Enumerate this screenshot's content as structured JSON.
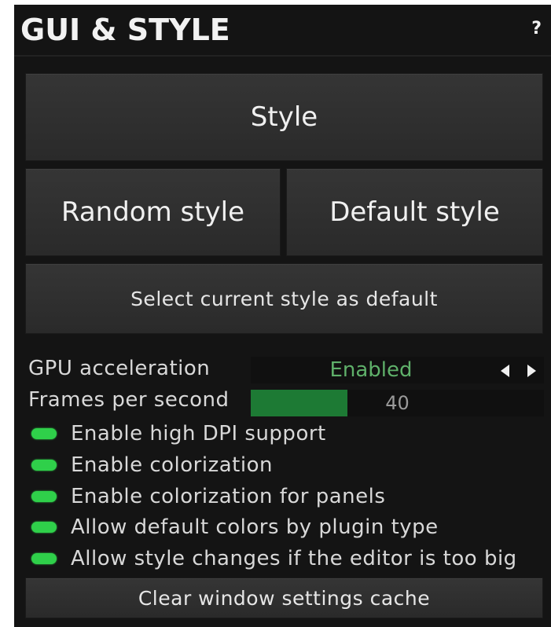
{
  "header": {
    "title": "GUI & STYLE",
    "help_label": "?"
  },
  "buttons": {
    "style": "Style",
    "random_style": "Random style",
    "default_style": "Default style",
    "select_default": "Select current style as default",
    "clear_cache": "Clear window settings cache"
  },
  "gpu": {
    "label": "GPU acceleration",
    "value": "Enabled",
    "value_color": "#5fb06a"
  },
  "fps": {
    "label": "Frames per second",
    "value": "40",
    "fill_fraction": 0.33,
    "fill_color": "#1d7a34"
  },
  "options": [
    {
      "label": "Enable high DPI support",
      "on": true
    },
    {
      "label": "Enable colorization",
      "on": true
    },
    {
      "label": "Enable colorization for panels",
      "on": true
    },
    {
      "label": "Allow default colors by plugin type",
      "on": true
    },
    {
      "label": "Allow style changes if the editor is too big",
      "on": true
    }
  ],
  "colors": {
    "panel_bg": "#141414",
    "led_on": "#2fd04a"
  }
}
